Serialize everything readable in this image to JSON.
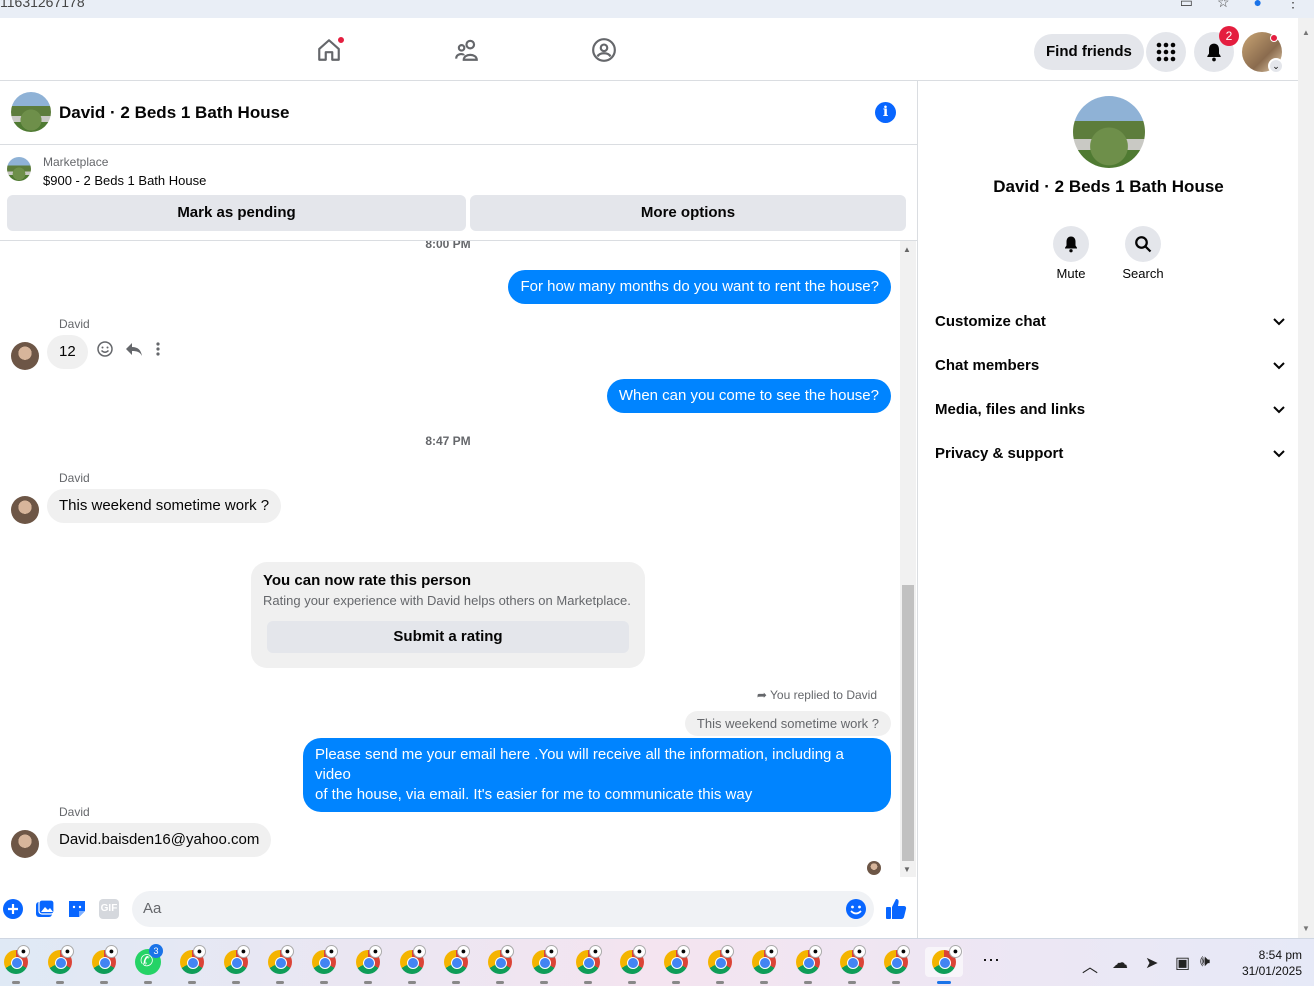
{
  "browser": {
    "url_fragment": "11631267178"
  },
  "topnav": {
    "find_friends": "Find friends",
    "notif_count": "2"
  },
  "chat": {
    "title": "David · 2 Beds 1 Bath House",
    "marketplace_label": "Marketplace",
    "listing": "$900 - 2 Beds 1 Bath House",
    "mark_pending": "Mark as pending",
    "more_options": "More options"
  },
  "messages": {
    "ts1": "8:00 PM",
    "out1": "For how many months do you want to rent the house?",
    "sender1": "David",
    "in1": "12",
    "out2": "When can you come to see the house?",
    "ts2": "8:47 PM",
    "sender2": "David",
    "in2": "This weekend sometime work ?",
    "rate_title": "You can now rate this person",
    "rate_sub": "Rating your experience with David helps others on Marketplace.",
    "rate_btn": "Submit a rating",
    "replied_label": "You replied to David",
    "quoted": "This weekend sometime work ?",
    "out3_line1": "Please send me your email here .You will receive all the information, including a video",
    "out3_line2": "of the house, via email. It's easier for me to communicate this way",
    "sender3": "David",
    "in3": "David.baisden16@yahoo.com"
  },
  "composer": {
    "placeholder": "Aa",
    "gif_label": "GIF"
  },
  "sidebar": {
    "name": "David · 2 Beds 1 Bath House",
    "mute": "Mute",
    "search": "Search",
    "rows": [
      "Customize chat",
      "Chat members",
      "Media, files and links",
      "Privacy & support"
    ]
  },
  "taskbar": {
    "time": "8:54 pm",
    "date": "31/01/2025",
    "whatsapp_badge": "3"
  },
  "colors": {
    "accent": "#0084ff",
    "badge": "#e41e3f",
    "bubble_in": "#f0f0f0"
  }
}
